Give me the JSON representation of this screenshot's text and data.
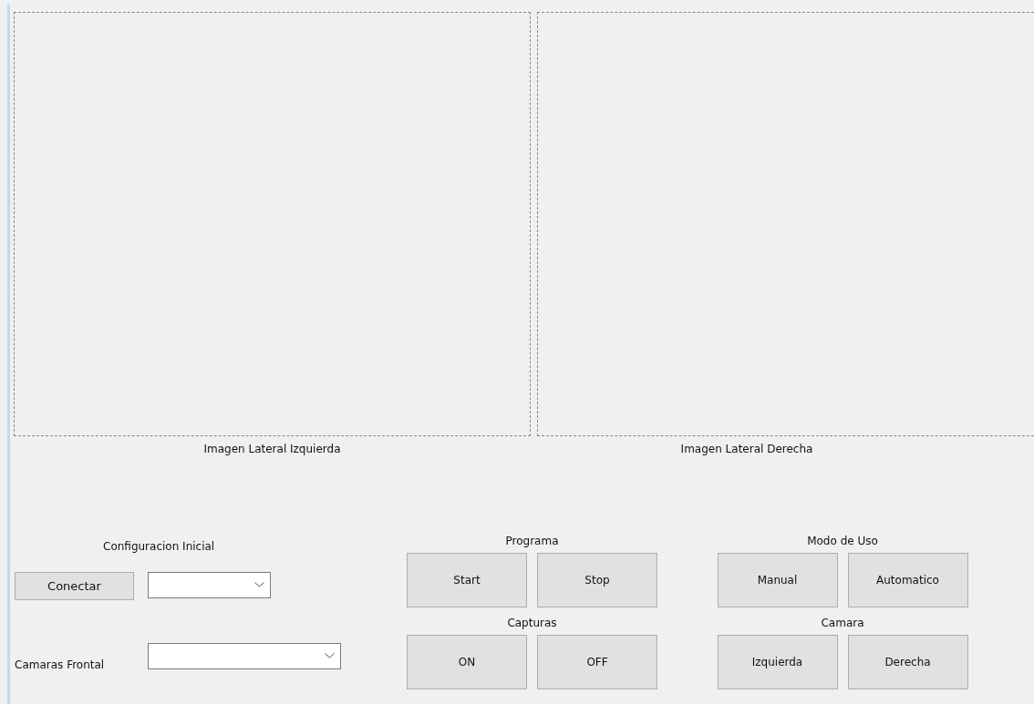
{
  "image_panels": [
    {
      "caption": "Imagen Lateral Izquierda"
    },
    {
      "caption": "Imagen Lateral Derecha"
    }
  ],
  "config": {
    "title": "Configuracion Inicial",
    "connect_button": "Conectar",
    "camera_label": "Camaras Frontal"
  },
  "groups": [
    {
      "title": "Programa",
      "buttons": [
        "Start",
        "Stop"
      ]
    },
    {
      "title": "Modo de Uso",
      "buttons": [
        "Manual",
        "Automatico"
      ]
    },
    {
      "title": "Capturas",
      "buttons": [
        "ON",
        "OFF"
      ]
    },
    {
      "title": "Camara",
      "buttons": [
        "Izquierda",
        "Derecha"
      ]
    }
  ]
}
